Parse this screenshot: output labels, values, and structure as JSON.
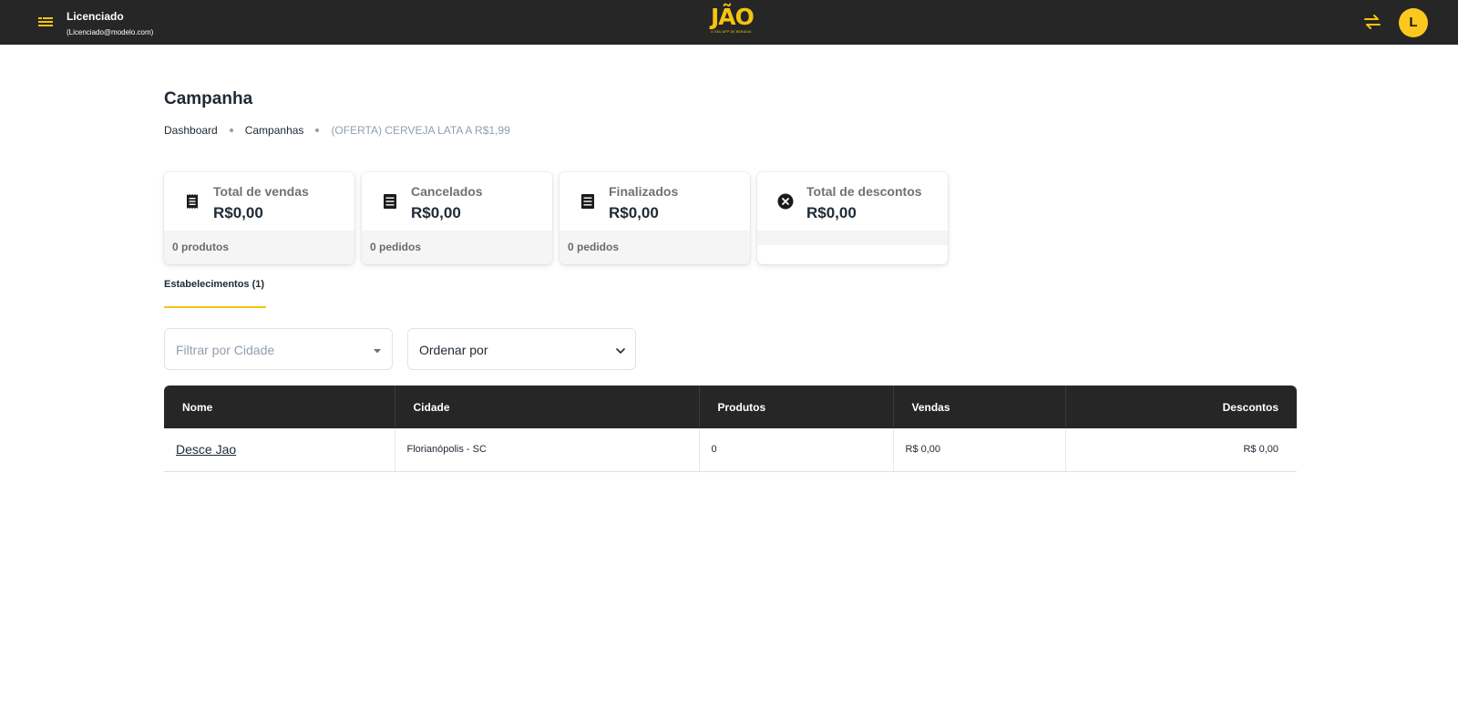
{
  "header": {
    "user_name": "Licenciado",
    "user_email": "(Licenciado@modelo.com)",
    "logo_text": "JÃO",
    "logo_tagline": "O SEU APP DE BEBIDAS",
    "avatar_initial": "L",
    "accent_color": "#f6c40d"
  },
  "page": {
    "title": "Campanha",
    "breadcrumb": [
      "Dashboard",
      "Campanhas",
      "(OFERTA) CERVEJA LATA A R$1,99"
    ]
  },
  "cards": [
    {
      "label": "Total de vendas",
      "value": "R$0,00",
      "footer": "0 produtos",
      "icon": "receipt-icon"
    },
    {
      "label": "Cancelados",
      "value": "R$0,00",
      "footer": "0 pedidos",
      "icon": "list-icon"
    },
    {
      "label": "Finalizados",
      "value": "R$0,00",
      "footer": "0 pedidos",
      "icon": "list-icon"
    },
    {
      "label": "Total de descontos",
      "value": "R$0,00",
      "footer": "",
      "icon": "cancel-circle-icon"
    }
  ],
  "tabs": [
    {
      "label": "Estabelecimentos (1)",
      "active": true
    }
  ],
  "filters": {
    "city_placeholder": "Filtrar por Cidade",
    "order_value": "Ordenar por"
  },
  "table": {
    "columns": [
      "Nome",
      "Cidade",
      "Produtos",
      "Vendas",
      "Descontos"
    ],
    "rows": [
      [
        "Desce Jao",
        "Florianópolis - SC",
        "0",
        "R$ 0,00",
        "R$ 0,00"
      ]
    ]
  }
}
